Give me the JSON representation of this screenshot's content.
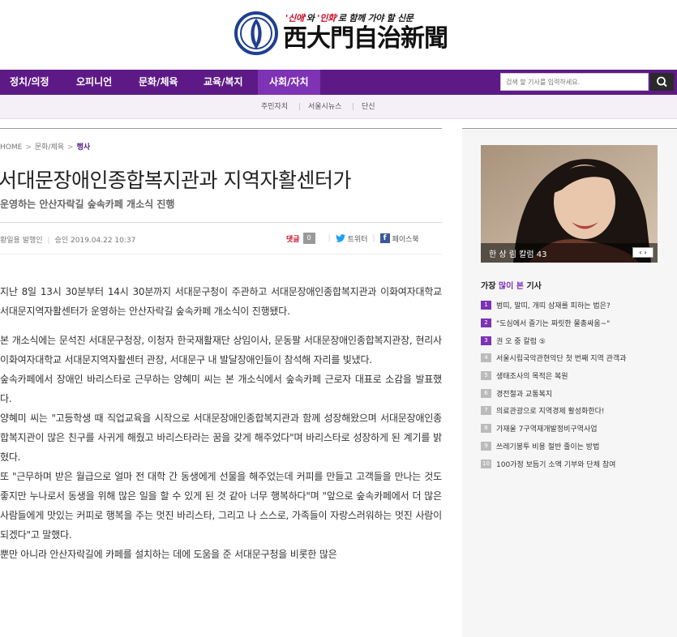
{
  "masthead": {
    "slogan_pre": "'신애'",
    "slogan_mid": "와 ",
    "slogan_hl": "'인화'",
    "slogan_post": "로 함께 가야 할 신문",
    "title": "西大門自治新聞"
  },
  "nav": {
    "items": [
      "정치/의정",
      "오피니언",
      "문화/체육",
      "교육/복지",
      "사회/자치"
    ],
    "active": "사회/자치",
    "search_placeholder": "검색 할 기사를 입력하세요."
  },
  "subnav": {
    "items": [
      "주민자치",
      "서울시뉴스",
      "단신"
    ]
  },
  "article": {
    "breadcrumb": [
      "HOME",
      "문화/체육",
      "행사"
    ],
    "headline": "서대문장애인종합복지관과 지역자활센터가",
    "subhead": "운영하는 안산자락길 숲속카페 개소식 진행",
    "author": "황일용 발행인",
    "approved": "승인 2019.04.22 10:37",
    "comment_label": "댓글",
    "comment_count": "0",
    "twitter": "트위터",
    "facebook": "페이스북",
    "paragraphs": [
      "지난 8일 13시 30분부터 14시 30분까지 서대문구청이 주관하고 서대문장애인종합복지관과 이화여자대학교 서대문지역자활센터가 운영하는 안산자락길 숲속카페 개소식이 진행됐다.",
      "본 개소식에는 문석진 서대문구청장, 이청자 한국재활재단 상임이사, 문동팔 서대문장애인종합복지관장, 현리사 이화여자대학교 서대문지역자활센터 관장, 서대문구 내 발달장애인들이 참석해 자리를 빛냈다.",
      "숲속카페에서 장애인 바리스타로 근무하는 양혜미 씨는 본 개소식에서 숲속카페 근로자 대표로 소감을 발표했다.",
      "양혜미 씨는 \"고등학생 때 직업교육을 시작으로 서대문장애인종합복지관과 함께 성장해왔으며 서대문장애인종합복지관이 많은 친구를 사귀게 해줬고 바리스타라는 꿈을 갖게 해주었다\"며 바리스타로 성장하게 된 계기를 밝혔다.",
      "또 \"근무하며 받은 월급으로 얼마 전 대학 간 동생에게 선물을 해주었는데 커피를 만들고 고객들을 만나는 것도 좋지만 누나로서 동생을 위해 많은 일을 할 수 있게 된 것 같아 너무 행복하다\"며 \"앞으로 숲속카페에서 더 많은 사람들에게 맛있는 커피로 행복을 주는 멋진 바리스타, 그리고 나 스스로, 가족들이 자랑스러워하는 멋진 사람이 되겠다\"고 말했다.",
      "뿐만 아니라 안산자락길에 카페를 설치하는 데에 도움을 준 서대문구청을 비롯한 많은"
    ]
  },
  "sidebar": {
    "column_caption": "한 상 림 칼럼 43",
    "popular_title_pre": "가장 ",
    "popular_title_hl": "많이 본",
    "popular_title_post": " 기사",
    "popular": [
      "범띠, 말띠, 개띠 삼재를 피하는 법은?",
      "\"도심에서 즐기는 짜릿한 물총싸움~\"",
      "권 오 중 칼럼 ⑤",
      "서울시립국악관현악단 첫 번째 지역 관객과",
      "생태조사의 목적은 복원",
      "경전철과 교통복지",
      "의료관광으로 지역경제 활성화한다!",
      "가재울 7구역재개발정비구역사업",
      "쓰레기봉투 비용 절반 줄이는 방법",
      "100가정 보듬기 소액 기부와 단체 참여"
    ],
    "ranks": [
      "1",
      "2",
      "3",
      "4",
      "5",
      "6",
      "7",
      "8",
      "9",
      "10"
    ]
  }
}
